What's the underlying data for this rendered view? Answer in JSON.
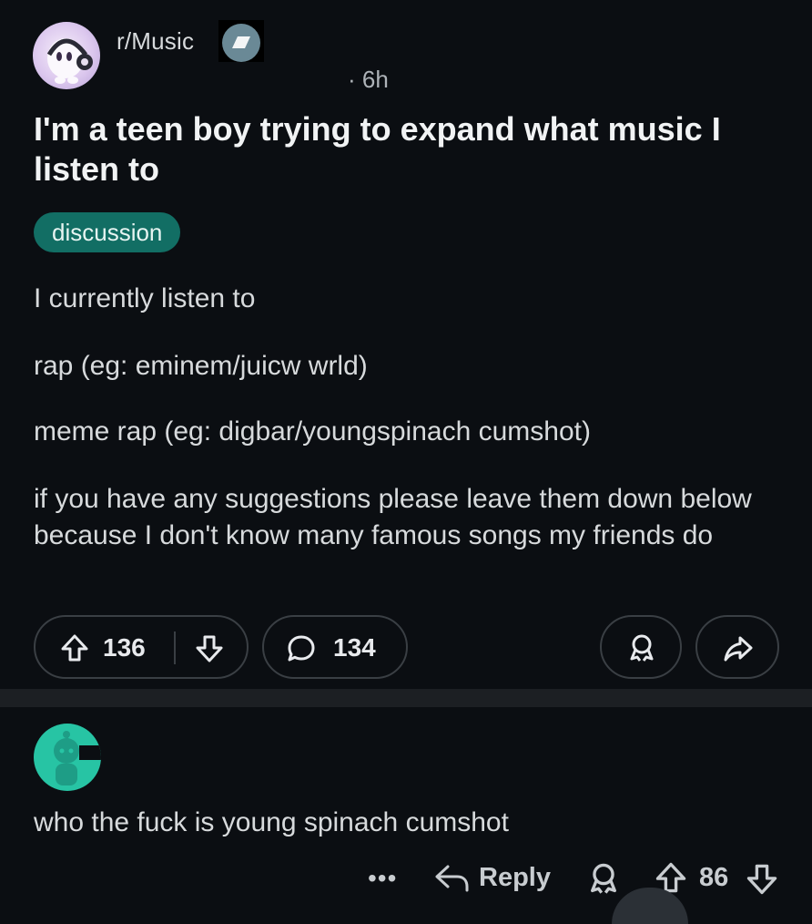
{
  "post": {
    "subreddit": "r/Music",
    "time": "· 6h",
    "title": "I'm a teen boy trying to expand what music I listen to",
    "flair": "discussion",
    "paragraphs": [
      "I currently listen to",
      "rap (eg: eminem/juicw wrld)",
      "meme rap (eg: digbar/youngspinach cumshot)",
      "if you have any suggestions please leave them down below because I don't know many famous songs my friends do"
    ],
    "score": "136",
    "comments": "134",
    "icons": {
      "upvote": "upvote-arrow-icon",
      "downvote": "downvote-arrow-icon",
      "comment": "speech-bubble-icon",
      "award": "award-icon",
      "share": "share-arrow-icon"
    }
  },
  "comment": {
    "text": "who the fuck is young spinach cumshot",
    "more": "•••",
    "reply_label": "Reply",
    "score": "86"
  },
  "colors": {
    "background": "#0b0e12",
    "flair": "#126e64",
    "comment_avatar": "#27c4a4",
    "subreddit_badge": "#6a8996"
  }
}
